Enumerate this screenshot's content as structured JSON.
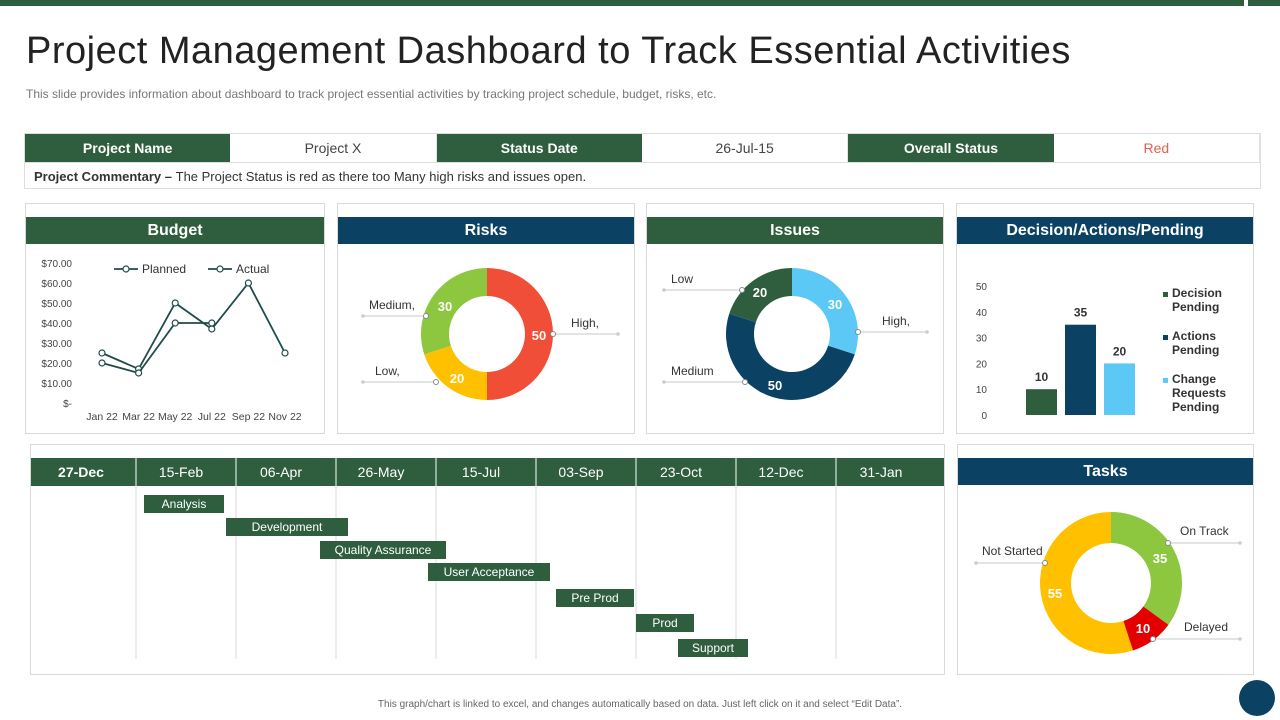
{
  "header": {
    "title": "Project Management Dashboard to Track Essential Activities",
    "subtitle": "This slide provides information about dashboard to track project essential activities by tracking project schedule, budget, risks, etc."
  },
  "info": {
    "project_name_label": "Project Name",
    "project_name_value": "Project X",
    "status_date_label": "Status Date",
    "status_date_value": "26-Jul-15",
    "overall_status_label": "Overall Status",
    "overall_status_value": "Red",
    "commentary_label": "Project Commentary –",
    "commentary_text": "The Project Status is red as there too Many high risks and issues open."
  },
  "panels": {
    "budget": "Budget",
    "risks": "Risks",
    "issues": "Issues",
    "decision": "Decision/Actions/Pending",
    "tasks": "Tasks"
  },
  "colors": {
    "header_green": "#2e5e3e",
    "header_navy": "#0b4263",
    "red": "#f04e37",
    "green": "#8dc63f",
    "yellow": "#ffc000",
    "dark_green": "#2e5e3e",
    "navy": "#0b4263",
    "light_blue": "#5bc8f5",
    "task_red": "#e50000"
  },
  "chart_data": [
    {
      "type": "line",
      "name": "budget",
      "categories": [
        "Jan 22",
        "Mar 22",
        "May 22",
        "Jul 22",
        "Sep 22",
        "Nov 22"
      ],
      "y_ticks": [
        "$70.00",
        "$60.00",
        "$50.00",
        "$40.00",
        "$30.00",
        "$20.00",
        "$10.00",
        "$-"
      ],
      "ylim": [
        0,
        70
      ],
      "legend_position": "top",
      "series": [
        {
          "name": "Planned",
          "x": [
            0,
            1,
            2,
            3,
            4,
            5
          ],
          "values": [
            25,
            17,
            50,
            37,
            60,
            25
          ]
        },
        {
          "name": "Actual",
          "x": [
            0,
            1,
            2,
            3
          ],
          "values": [
            20,
            15,
            40,
            40
          ]
        }
      ]
    },
    {
      "type": "pie",
      "name": "risks",
      "slices": [
        {
          "label": "High,",
          "value": 50,
          "color": "#f04e37"
        },
        {
          "label": "Low,",
          "value": 20,
          "color": "#ffc000"
        },
        {
          "label": "Medium,",
          "value": 30,
          "color": "#8dc63f"
        }
      ]
    },
    {
      "type": "pie",
      "name": "issues",
      "slices": [
        {
          "label": "High,",
          "value": 30,
          "color": "#5bc8f5"
        },
        {
          "label": "Medium",
          "value": 50,
          "color": "#0b4263"
        },
        {
          "label": "Low",
          "value": 20,
          "color": "#2e5e3e"
        }
      ]
    },
    {
      "type": "bar",
      "name": "decision_actions_pending",
      "categories": [
        "Decision Pending",
        "Actions Pending",
        "Change Requests Pending"
      ],
      "values": [
        10,
        35,
        20
      ],
      "colors": [
        "#2e5e3e",
        "#0b4263",
        "#5bc8f5"
      ],
      "y_ticks": [
        "50",
        "40",
        "30",
        "20",
        "10",
        "0"
      ],
      "ylim": [
        0,
        50
      ],
      "legend_position": "right",
      "legend": [
        "Decision Pending",
        "Actions Pending",
        "Change Requests Pending"
      ]
    },
    {
      "type": "bar",
      "name": "timeline",
      "columns": [
        "27-Dec",
        "15-Feb",
        "06-Apr",
        "26-May",
        "15-Jul",
        "03-Sep",
        "23-Oct",
        "12-Dec",
        "31-Jan"
      ],
      "tasks": [
        {
          "label": "Analysis",
          "start": "2022-02-19",
          "end": "2022-03-31"
        },
        {
          "label": "Development",
          "start": "2022-04-01",
          "end": "2022-06-01"
        },
        {
          "label": "Quality Assurance",
          "start": "2022-05-18",
          "end": "2022-07-20"
        },
        {
          "label": "User Acceptance",
          "start": "2022-07-11",
          "end": "2022-09-10"
        },
        {
          "label": "Pre Prod",
          "start": "2022-09-13",
          "end": "2022-10-22"
        },
        {
          "label": "Prod",
          "start": "2022-10-23",
          "end": "2022-11-21"
        },
        {
          "label": "Support",
          "start": "2022-11-13",
          "end": "2022-12-18"
        }
      ]
    },
    {
      "type": "pie",
      "name": "tasks",
      "slices": [
        {
          "label": "On Track",
          "value": 35,
          "color": "#8dc63f"
        },
        {
          "label": "Delayed",
          "value": 10,
          "color": "#e50000"
        },
        {
          "label": "Not Started",
          "value": 55,
          "color": "#ffc000"
        }
      ]
    }
  ],
  "footer": {
    "note": "This graph/chart is linked to excel, and changes automatically based on data. Just left click on it and select “Edit Data”."
  }
}
